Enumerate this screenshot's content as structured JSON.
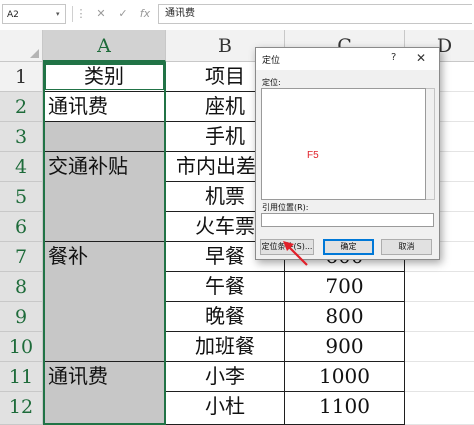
{
  "formula_bar": {
    "name_box": "A2",
    "name_box_arrow": "▾",
    "icons": {
      "more": "⋮",
      "cancel": "✕",
      "confirm": "✓",
      "function": "fx"
    },
    "formula": "通讯费"
  },
  "columns": [
    {
      "label": "A",
      "selected": true
    },
    {
      "label": "B",
      "selected": false
    },
    {
      "label": "C",
      "selected": false
    },
    {
      "label": "D",
      "selected": false
    }
  ],
  "rows": [
    {
      "num": "1",
      "a": "类别",
      "b": "项目",
      "c": ""
    },
    {
      "num": "2",
      "a": "通讯费",
      "b": "座机",
      "c": ""
    },
    {
      "num": "3",
      "a": "",
      "b": "手机",
      "c": ""
    },
    {
      "num": "4",
      "a": "交通补贴",
      "b": "市内出差",
      "c": ""
    },
    {
      "num": "5",
      "a": "",
      "b": "机票",
      "c": ""
    },
    {
      "num": "6",
      "a": "",
      "b": "火车票",
      "c": ""
    },
    {
      "num": "7",
      "a": "餐补",
      "b": "早餐",
      "c": "600"
    },
    {
      "num": "8",
      "a": "",
      "b": "午餐",
      "c": "700"
    },
    {
      "num": "9",
      "a": "",
      "b": "晚餐",
      "c": "800"
    },
    {
      "num": "10",
      "a": "",
      "b": "加班餐",
      "c": "900"
    },
    {
      "num": "11",
      "a": "通讯费",
      "b": "小李",
      "c": "1000"
    },
    {
      "num": "12",
      "a": "",
      "b": "小杜",
      "c": "1100"
    }
  ],
  "dialog": {
    "title": "定位",
    "help": "?",
    "close": "✕",
    "goto_label": "定位:",
    "annotation": "F5",
    "reference_label": "引用位置(R):",
    "reference_value": "",
    "buttons": {
      "special": "定位条件(S)...",
      "ok": "确定",
      "cancel": "取消"
    }
  },
  "colors": {
    "selection": "#217346",
    "selected_fill": "#c7c7c7",
    "annotation": "#e0202a"
  }
}
